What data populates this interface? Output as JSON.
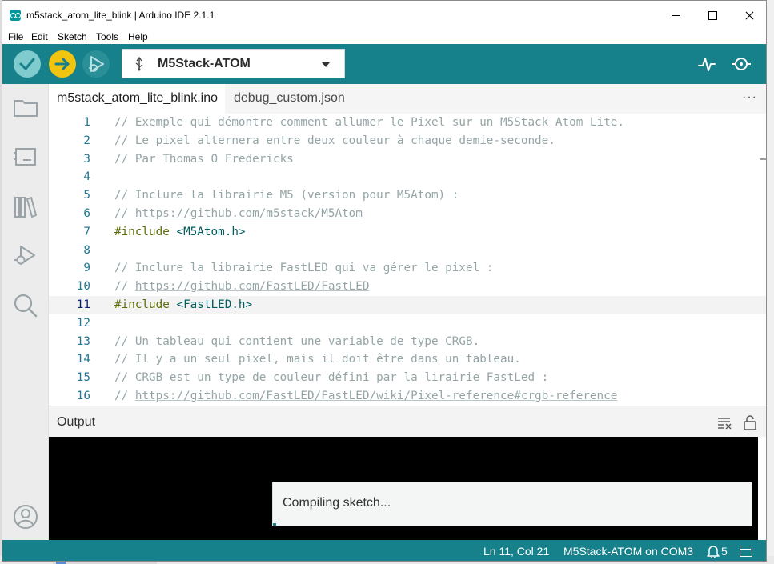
{
  "window": {
    "title": "m5stack_atom_lite_blink | Arduino IDE 2.1.1"
  },
  "menu": [
    "File",
    "Edit",
    "Sketch",
    "Tools",
    "Help"
  ],
  "toolbar": {
    "verify_icon": "check-icon",
    "upload_icon": "arrow-right-icon",
    "debug_icon": "debug-icon",
    "board": "M5Stack-ATOM",
    "plotter_icon": "serial-plotter-icon",
    "monitor_icon": "serial-monitor-icon"
  },
  "sidebar": [
    "sketchbook-icon",
    "boards-manager-icon",
    "library-manager-icon",
    "debug-icon",
    "search-icon",
    "account-icon"
  ],
  "tabs": [
    {
      "label": "m5stack_atom_lite_blink.ino",
      "active": true
    },
    {
      "label": "debug_custom.json",
      "active": false
    }
  ],
  "tabbar_more": "···",
  "editor": {
    "current_line": 11,
    "lines": [
      {
        "n": "1",
        "parts": [
          {
            "t": "// Exemple qui démontre comment allumer le Pixel sur un M5Stack Atom Lite.",
            "k": "comment"
          }
        ]
      },
      {
        "n": "2",
        "parts": [
          {
            "t": "// Le pixel alternera entre deux couleur à chaque demie-seconde.",
            "k": "comment"
          }
        ]
      },
      {
        "n": "3",
        "parts": [
          {
            "t": "// Par Thomas O Fredericks",
            "k": "comment"
          }
        ]
      },
      {
        "n": "4",
        "parts": []
      },
      {
        "n": "5",
        "parts": [
          {
            "t": "// Inclure la librairie M5 (version pour M5Atom) :",
            "k": "comment"
          }
        ]
      },
      {
        "n": "6",
        "parts": [
          {
            "t": "// ",
            "k": "comment"
          },
          {
            "t": "https://github.com/m5stack/M5Atom",
            "k": "link"
          }
        ]
      },
      {
        "n": "7",
        "parts": [
          {
            "t": "#include ",
            "k": "pre"
          },
          {
            "t": "<M5Atom.h>",
            "k": "inc"
          }
        ]
      },
      {
        "n": "8",
        "parts": []
      },
      {
        "n": "9",
        "parts": [
          {
            "t": "// Inclure la librairie FastLED qui va gérer le pixel :",
            "k": "comment"
          }
        ]
      },
      {
        "n": "10",
        "parts": [
          {
            "t": "// ",
            "k": "comment"
          },
          {
            "t": "https://github.com/FastLED/FastLED",
            "k": "link"
          }
        ]
      },
      {
        "n": "11",
        "parts": [
          {
            "t": "#include ",
            "k": "pre"
          },
          {
            "t": "<FastLED.h>",
            "k": "inc"
          }
        ]
      },
      {
        "n": "12",
        "parts": []
      },
      {
        "n": "13",
        "parts": [
          {
            "t": "// Un tableau qui contient une variable de type CRGB.",
            "k": "comment"
          }
        ]
      },
      {
        "n": "14",
        "parts": [
          {
            "t": "// Il y a un seul pixel, mais il doit être dans un tableau.",
            "k": "comment"
          }
        ]
      },
      {
        "n": "15",
        "parts": [
          {
            "t": "// CRGB est un type de couleur défini par la lirairie FastLed :",
            "k": "comment"
          }
        ]
      },
      {
        "n": "16",
        "parts": [
          {
            "t": "// ",
            "k": "comment"
          },
          {
            "t": "https://github.com/FastLED/FastLED/wiki/Pixel-reference#crgb-reference",
            "k": "link"
          }
        ]
      }
    ]
  },
  "output": {
    "title": "Output",
    "clear_icon": "clear-output-icon",
    "lock_icon": "scroll-lock-icon"
  },
  "notification": {
    "text": "Compiling sketch..."
  },
  "status": {
    "position": "Ln 11, Col 21",
    "board_port": "M5Stack-ATOM on COM3",
    "notifications_count": "5"
  },
  "colors": {
    "teal": "#17818b",
    "upload_yellow": "#f1c40f",
    "verify_teal": "#7fcbcd"
  }
}
